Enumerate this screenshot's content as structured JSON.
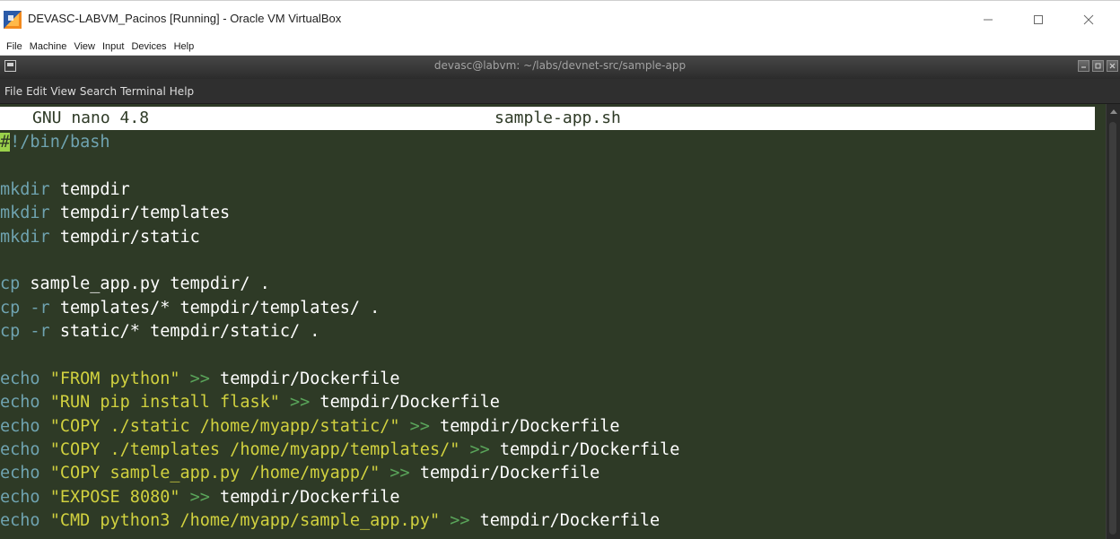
{
  "host_window": {
    "title": "DEVASC-LABVM_Pacinos [Running] - Oracle VM VirtualBox",
    "controls": {
      "minimize": "—",
      "maximize": "☐",
      "close": "✕"
    }
  },
  "vbox_menu": [
    "File",
    "Machine",
    "View",
    "Input",
    "Devices",
    "Help"
  ],
  "terminal_window": {
    "title": "devasc@labvm: ~/labs/devnet-src/sample-app"
  },
  "terminal_menu": [
    "File",
    "Edit",
    "View",
    "Search",
    "Terminal",
    "Help"
  ],
  "nano": {
    "version": "GNU nano 4.8",
    "filename": "sample-app.sh"
  },
  "code": {
    "shebang_hash": "#",
    "shebang_rest": "!/bin/bash",
    "mkdir_lines": [
      {
        "cmd": "mkdir",
        "arg": " tempdir"
      },
      {
        "cmd": "mkdir",
        "arg": " tempdir/templates"
      },
      {
        "cmd": "mkdir",
        "arg": " tempdir/static"
      }
    ],
    "cp_lines": [
      {
        "cmd": "cp",
        "flag": "",
        "arg": " sample_app.py tempdir/ ."
      },
      {
        "cmd": "cp",
        "flag": " -r",
        "arg": " templates/* tempdir/templates/ ."
      },
      {
        "cmd": "cp",
        "flag": " -r",
        "arg": " static/* tempdir/static/ ."
      }
    ],
    "echo_lines": [
      {
        "cmd": "echo",
        "str": " \"FROM python\"",
        "op": " >>",
        "target": " tempdir/Dockerfile"
      },
      {
        "cmd": "echo",
        "str": " \"RUN pip install flask\"",
        "op": " >>",
        "target": " tempdir/Dockerfile"
      },
      {
        "cmd": "echo",
        "str": " \"COPY ./static /home/myapp/static/\"",
        "op": " >>",
        "target": " tempdir/Dockerfile"
      },
      {
        "cmd": "echo",
        "str": " \"COPY ./templates /home/myapp/templates/\"",
        "op": " >>",
        "target": " tempdir/Dockerfile"
      },
      {
        "cmd": "echo",
        "str": " \"COPY sample_app.py /home/myapp/\"",
        "op": " >>",
        "target": " tempdir/Dockerfile"
      },
      {
        "cmd": "echo",
        "str": " \"EXPOSE 8080\"",
        "op": " >>",
        "target": " tempdir/Dockerfile"
      },
      {
        "cmd": "echo",
        "str": " \"CMD python3 /home/myapp/sample_app.py\"",
        "op": " >>",
        "target": " tempdir/Dockerfile"
      }
    ]
  },
  "colors": {
    "terminal_bg": "#2e3a26",
    "keyword": "#6fa3b0",
    "string": "#d1d13f",
    "operator": "#5aa55a",
    "cursor": "#9ad14a"
  }
}
